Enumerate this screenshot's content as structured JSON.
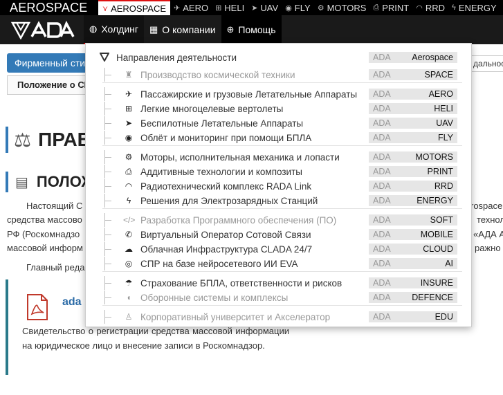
{
  "top_strip": {
    "brand": "AEROSPACE",
    "tabs": [
      {
        "label": "AEROSPACE",
        "icon": "aerospace-logo-icon",
        "glyph": "⋎",
        "active": true
      },
      {
        "label": "AERO",
        "icon": "plane-icon",
        "glyph": "✈",
        "active": false
      },
      {
        "label": "HELI",
        "icon": "helipad-icon",
        "glyph": "⊞",
        "active": false
      },
      {
        "label": "UAV",
        "icon": "paper-plane-icon",
        "glyph": "➤",
        "active": false
      },
      {
        "label": "FLY",
        "icon": "eye-icon",
        "glyph": "◉",
        "active": false
      },
      {
        "label": "MOTORS",
        "icon": "gears-icon",
        "glyph": "⚙",
        "active": false
      },
      {
        "label": "PRINT",
        "icon": "printer-icon",
        "glyph": "⎙",
        "active": false
      },
      {
        "label": "RRD",
        "icon": "wifi-icon",
        "glyph": "◠",
        "active": false
      },
      {
        "label": "ENERGY",
        "icon": "bolt-icon",
        "glyph": "ϟ",
        "active": false
      }
    ]
  },
  "nav": {
    "logo_text": "ADA",
    "items": [
      {
        "label": "Холдинг",
        "icon": "globe-icon",
        "glyph": "◍"
      },
      {
        "label": "О компании",
        "icon": "building-icon",
        "glyph": "▦"
      },
      {
        "label": "Помощь",
        "icon": "lifebuoy-icon",
        "glyph": "⊕"
      }
    ]
  },
  "page": {
    "blue_button": "Фирменный стиль",
    "breadcrumb": "Положение о СМИ",
    "breadcrumb_right": "дальность",
    "heading1": "ПРАВ",
    "heading2": "ПОЛОЖ",
    "para_lines": [
      {
        "left": "Настоящий  С",
        "right": "rospace"
      },
      {
        "left": "средства массово",
        "right": "технол"
      },
      {
        "left": "РФ (Роскомнадзо",
        "right": "«АДА А"
      },
      {
        "left": "массовой информ",
        "right": "ражно"
      }
    ],
    "editor_line": "Главный реда",
    "doc_link": "ada",
    "doc_description": "Свидетельство о регистрации средства массовой информации на юридическое лицо и внесение записи в Роскомнадзор."
  },
  "dropdown": {
    "header": "Направления деятельности",
    "header_tag": {
      "prefix": "ADA",
      "code": "Aerospace"
    },
    "groups": [
      [
        {
          "label": "Производство космической техники",
          "code": "SPACE",
          "icon": "shuttle-icon",
          "glyph": "♜",
          "dim": true
        }
      ],
      [
        {
          "label": "Пассажирские и грузовые Летательные Аппараты",
          "code": "AERO",
          "icon": "plane-icon",
          "glyph": "✈",
          "dim": false
        },
        {
          "label": "Легкие многоцелевые вертолеты",
          "code": "HELI",
          "icon": "helipad-icon",
          "glyph": "⊞",
          "dim": false
        },
        {
          "label": "Беспилотные Летательные Аппараты",
          "code": "UAV",
          "icon": "paper-plane-icon",
          "glyph": "➤",
          "dim": false
        },
        {
          "label": "Облёт и мониторинг при помощи БПЛА",
          "code": "FLY",
          "icon": "eye-icon",
          "glyph": "◉",
          "dim": false
        }
      ],
      [
        {
          "label": "Моторы, исполнительная механика и лопасти",
          "code": "MOTORS",
          "icon": "gears-icon",
          "glyph": "⚙",
          "dim": false
        },
        {
          "label": "Аддитивные технологии и композиты",
          "code": "PRINT",
          "icon": "printer-icon",
          "glyph": "⎙",
          "dim": false
        },
        {
          "label": "Радиотехнический комплекс RADA Link",
          "code": "RRD",
          "icon": "wifi-icon",
          "glyph": "◠",
          "dim": false
        },
        {
          "label": "Решения для Электрозарядных Станций",
          "code": "ENERGY",
          "icon": "bolt-icon",
          "glyph": "ϟ",
          "dim": false
        }
      ],
      [
        {
          "label": "Разработка Программного обеспечения (ПО)",
          "code": "SOFT",
          "icon": "code-icon",
          "glyph": "</>",
          "dim": true
        },
        {
          "label": "Виртуальный Оператор Сотовой Связи",
          "code": "MOBILE",
          "icon": "phone-icon",
          "glyph": "✆",
          "dim": false
        },
        {
          "label": "Облачная Инфраструктура CLADA 24/7",
          "code": "CLOUD",
          "icon": "cloud-icon",
          "glyph": "☁",
          "dim": false
        },
        {
          "label": "СПР на базе нейросетевого ИИ EVA",
          "code": "AI",
          "icon": "vr-headset-icon",
          "glyph": "◎",
          "dim": false
        }
      ],
      [
        {
          "label": "Страхование БПЛА, ответственности и рисков",
          "code": "INSURE",
          "icon": "umbrella-icon",
          "glyph": "☂",
          "dim": false
        },
        {
          "label": "Оборонные системы и комплексы",
          "code": "DEFENCE",
          "icon": "shield-icon",
          "glyph": "◖",
          "dim": true
        }
      ],
      [
        {
          "label": "Корпоративный университет и Акселератор",
          "code": "EDU",
          "icon": "graduation-cap-icon",
          "glyph": "♙",
          "dim": true
        }
      ]
    ],
    "tag_prefix": "ADA"
  },
  "colors": {
    "accent": "#d11111",
    "blue": "#337ab7",
    "teal": "#2a7a8a",
    "navbar": "#1a1a1a"
  }
}
